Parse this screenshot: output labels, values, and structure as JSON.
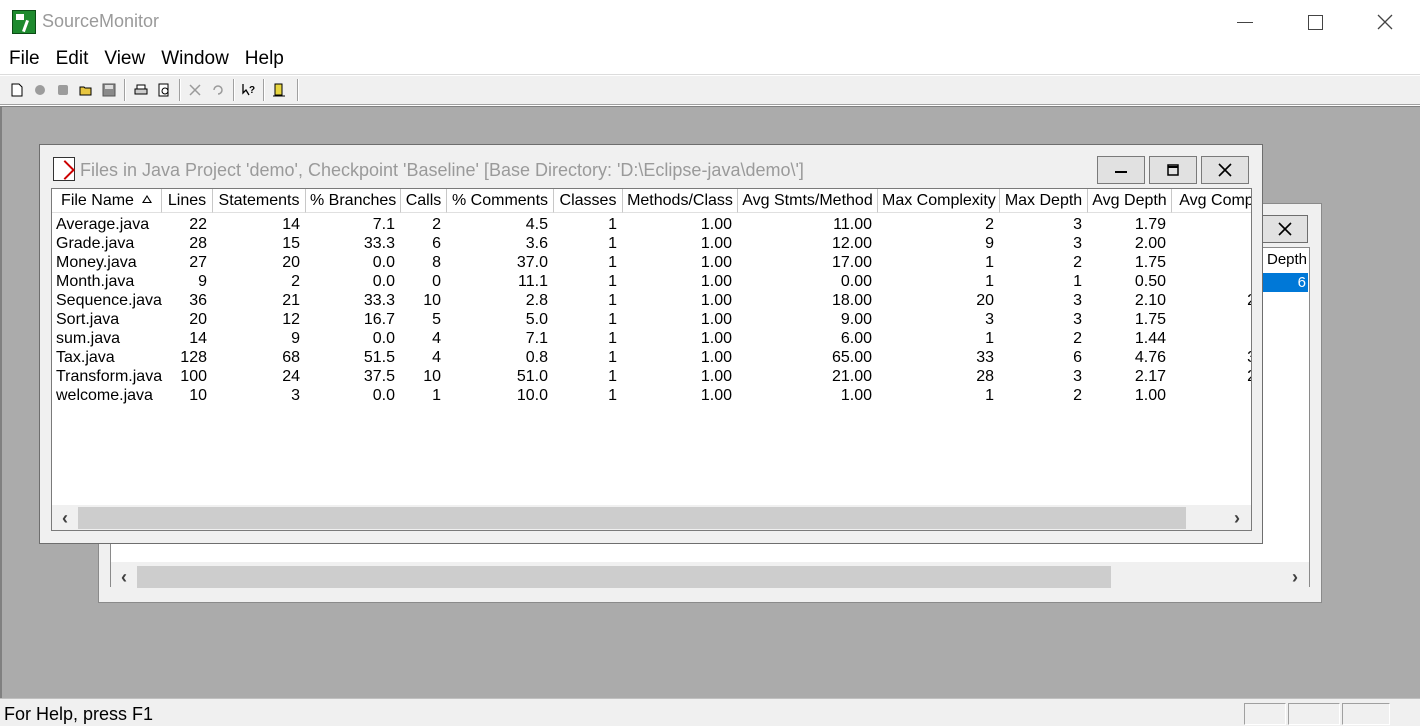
{
  "app": {
    "title": "SourceMonitor"
  },
  "menu": [
    "File",
    "Edit",
    "View",
    "Window",
    "Help"
  ],
  "toolbar": {
    "buttons": [
      "new-icon",
      "open-project-icon",
      "checkpoint-icon",
      "open-folder-icon",
      "save-icon",
      "print-icon",
      "print-preview-icon",
      "delete-icon",
      "undo-icon",
      "context-help-icon",
      "exit-icon"
    ]
  },
  "front_window": {
    "title": "Files in Java Project 'demo', Checkpoint 'Baseline'  [Base Directory: 'D:\\Eclipse-java\\demo\\']",
    "columns": [
      "File Name",
      "Lines",
      "Statements",
      "% Branches",
      "Calls",
      "% Comments",
      "Classes",
      "Methods/Class",
      "Avg Stmts/Method",
      "Max Complexity",
      "Max Depth",
      "Avg Depth",
      "Avg Comp"
    ],
    "sorted_column": "File Name",
    "rows": [
      [
        "Average.java",
        "22",
        "14",
        "7.1",
        "2",
        "4.5",
        "1",
        "1.00",
        "11.00",
        "2",
        "3",
        "1.79",
        ""
      ],
      [
        "Grade.java",
        "28",
        "15",
        "33.3",
        "6",
        "3.6",
        "1",
        "1.00",
        "12.00",
        "9",
        "3",
        "2.00",
        ""
      ],
      [
        "Money.java",
        "27",
        "20",
        "0.0",
        "8",
        "37.0",
        "1",
        "1.00",
        "17.00",
        "1",
        "2",
        "1.75",
        ""
      ],
      [
        "Month.java",
        "9",
        "2",
        "0.0",
        "0",
        "11.1",
        "1",
        "1.00",
        "0.00",
        "1",
        "1",
        "0.50",
        ""
      ],
      [
        "Sequence.java",
        "36",
        "21",
        "33.3",
        "10",
        "2.8",
        "1",
        "1.00",
        "18.00",
        "20",
        "3",
        "2.10",
        "2"
      ],
      [
        "Sort.java",
        "20",
        "12",
        "16.7",
        "5",
        "5.0",
        "1",
        "1.00",
        "9.00",
        "3",
        "3",
        "1.75",
        ""
      ],
      [
        "sum.java",
        "14",
        "9",
        "0.0",
        "4",
        "7.1",
        "1",
        "1.00",
        "6.00",
        "1",
        "2",
        "1.44",
        ""
      ],
      [
        "Tax.java",
        "128",
        "68",
        "51.5",
        "4",
        "0.8",
        "1",
        "1.00",
        "65.00",
        "33",
        "6",
        "4.76",
        "3"
      ],
      [
        "Transform.java",
        "100",
        "24",
        "37.5",
        "10",
        "51.0",
        "1",
        "1.00",
        "21.00",
        "28",
        "3",
        "2.17",
        "2"
      ],
      [
        "welcome.java",
        "10",
        "3",
        "0.0",
        "1",
        "10.0",
        "1",
        "1.00",
        "1.00",
        "1",
        "2",
        "1.00",
        ""
      ]
    ]
  },
  "back_window": {
    "visible_header": "Depth",
    "selected_value": "6"
  },
  "status": {
    "text": "For Help, press F1"
  }
}
